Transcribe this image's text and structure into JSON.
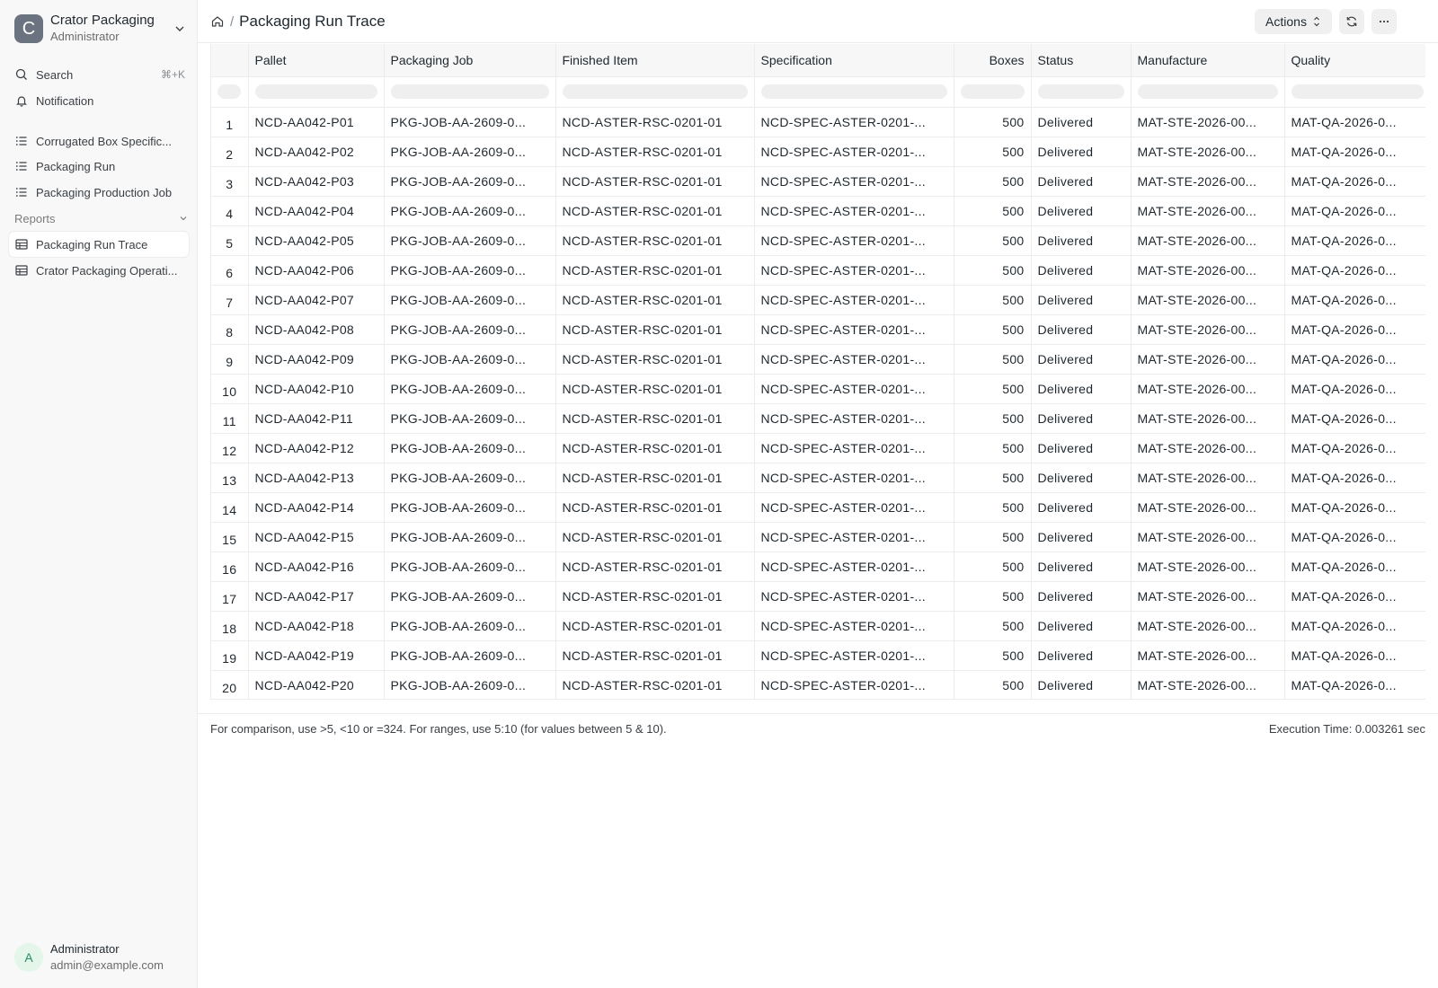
{
  "workspace": {
    "initial": "C",
    "name": "Crator Packaging",
    "role": "Administrator"
  },
  "sidebar": {
    "search_label": "Search",
    "search_shortcut": "⌘+K",
    "notification_label": "Notification",
    "items": [
      {
        "label": "Corrugated Box Specific...",
        "icon": "list-icon"
      },
      {
        "label": "Packaging Run",
        "icon": "list-icon"
      },
      {
        "label": "Packaging Production Job",
        "icon": "list-icon"
      }
    ],
    "reports_label": "Reports",
    "reports": [
      {
        "label": "Packaging Run Trace",
        "icon": "table-icon",
        "active": true
      },
      {
        "label": "Crator Packaging Operati...",
        "icon": "table-icon"
      }
    ]
  },
  "user": {
    "initial": "A",
    "name": "Administrator",
    "email": "admin@example.com"
  },
  "header": {
    "title": "Packaging Run Trace",
    "actions_label": "Actions"
  },
  "table": {
    "columns": [
      "Pallet",
      "Packaging Job",
      "Finished Item",
      "Specification",
      "Boxes",
      "Status",
      "Manufacture",
      "Quality"
    ],
    "rows": [
      [
        "1",
        "NCD-AA042-P01",
        "PKG-JOB-AA-2609-0...",
        "NCD-ASTER-RSC-0201-01",
        "NCD-SPEC-ASTER-0201-...",
        "500",
        "Delivered",
        "MAT-STE-2026-00...",
        "MAT-QA-2026-0..."
      ],
      [
        "2",
        "NCD-AA042-P02",
        "PKG-JOB-AA-2609-0...",
        "NCD-ASTER-RSC-0201-01",
        "NCD-SPEC-ASTER-0201-...",
        "500",
        "Delivered",
        "MAT-STE-2026-00...",
        "MAT-QA-2026-0..."
      ],
      [
        "3",
        "NCD-AA042-P03",
        "PKG-JOB-AA-2609-0...",
        "NCD-ASTER-RSC-0201-01",
        "NCD-SPEC-ASTER-0201-...",
        "500",
        "Delivered",
        "MAT-STE-2026-00...",
        "MAT-QA-2026-0..."
      ],
      [
        "4",
        "NCD-AA042-P04",
        "PKG-JOB-AA-2609-0...",
        "NCD-ASTER-RSC-0201-01",
        "NCD-SPEC-ASTER-0201-...",
        "500",
        "Delivered",
        "MAT-STE-2026-00...",
        "MAT-QA-2026-0..."
      ],
      [
        "5",
        "NCD-AA042-P05",
        "PKG-JOB-AA-2609-0...",
        "NCD-ASTER-RSC-0201-01",
        "NCD-SPEC-ASTER-0201-...",
        "500",
        "Delivered",
        "MAT-STE-2026-00...",
        "MAT-QA-2026-0..."
      ],
      [
        "6",
        "NCD-AA042-P06",
        "PKG-JOB-AA-2609-0...",
        "NCD-ASTER-RSC-0201-01",
        "NCD-SPEC-ASTER-0201-...",
        "500",
        "Delivered",
        "MAT-STE-2026-00...",
        "MAT-QA-2026-0..."
      ],
      [
        "7",
        "NCD-AA042-P07",
        "PKG-JOB-AA-2609-0...",
        "NCD-ASTER-RSC-0201-01",
        "NCD-SPEC-ASTER-0201-...",
        "500",
        "Delivered",
        "MAT-STE-2026-00...",
        "MAT-QA-2026-0..."
      ],
      [
        "8",
        "NCD-AA042-P08",
        "PKG-JOB-AA-2609-0...",
        "NCD-ASTER-RSC-0201-01",
        "NCD-SPEC-ASTER-0201-...",
        "500",
        "Delivered",
        "MAT-STE-2026-00...",
        "MAT-QA-2026-0..."
      ],
      [
        "9",
        "NCD-AA042-P09",
        "PKG-JOB-AA-2609-0...",
        "NCD-ASTER-RSC-0201-01",
        "NCD-SPEC-ASTER-0201-...",
        "500",
        "Delivered",
        "MAT-STE-2026-00...",
        "MAT-QA-2026-0..."
      ],
      [
        "10",
        "NCD-AA042-P10",
        "PKG-JOB-AA-2609-0...",
        "NCD-ASTER-RSC-0201-01",
        "NCD-SPEC-ASTER-0201-...",
        "500",
        "Delivered",
        "MAT-STE-2026-00...",
        "MAT-QA-2026-0..."
      ],
      [
        "11",
        "NCD-AA042-P11",
        "PKG-JOB-AA-2609-0...",
        "NCD-ASTER-RSC-0201-01",
        "NCD-SPEC-ASTER-0201-...",
        "500",
        "Delivered",
        "MAT-STE-2026-00...",
        "MAT-QA-2026-0..."
      ],
      [
        "12",
        "NCD-AA042-P12",
        "PKG-JOB-AA-2609-0...",
        "NCD-ASTER-RSC-0201-01",
        "NCD-SPEC-ASTER-0201-...",
        "500",
        "Delivered",
        "MAT-STE-2026-00...",
        "MAT-QA-2026-0..."
      ],
      [
        "13",
        "NCD-AA042-P13",
        "PKG-JOB-AA-2609-0...",
        "NCD-ASTER-RSC-0201-01",
        "NCD-SPEC-ASTER-0201-...",
        "500",
        "Delivered",
        "MAT-STE-2026-00...",
        "MAT-QA-2026-0..."
      ],
      [
        "14",
        "NCD-AA042-P14",
        "PKG-JOB-AA-2609-0...",
        "NCD-ASTER-RSC-0201-01",
        "NCD-SPEC-ASTER-0201-...",
        "500",
        "Delivered",
        "MAT-STE-2026-00...",
        "MAT-QA-2026-0..."
      ],
      [
        "15",
        "NCD-AA042-P15",
        "PKG-JOB-AA-2609-0...",
        "NCD-ASTER-RSC-0201-01",
        "NCD-SPEC-ASTER-0201-...",
        "500",
        "Delivered",
        "MAT-STE-2026-00...",
        "MAT-QA-2026-0..."
      ],
      [
        "16",
        "NCD-AA042-P16",
        "PKG-JOB-AA-2609-0...",
        "NCD-ASTER-RSC-0201-01",
        "NCD-SPEC-ASTER-0201-...",
        "500",
        "Delivered",
        "MAT-STE-2026-00...",
        "MAT-QA-2026-0..."
      ],
      [
        "17",
        "NCD-AA042-P17",
        "PKG-JOB-AA-2609-0...",
        "NCD-ASTER-RSC-0201-01",
        "NCD-SPEC-ASTER-0201-...",
        "500",
        "Delivered",
        "MAT-STE-2026-00...",
        "MAT-QA-2026-0..."
      ],
      [
        "18",
        "NCD-AA042-P18",
        "PKG-JOB-AA-2609-0...",
        "NCD-ASTER-RSC-0201-01",
        "NCD-SPEC-ASTER-0201-...",
        "500",
        "Delivered",
        "MAT-STE-2026-00...",
        "MAT-QA-2026-0..."
      ],
      [
        "19",
        "NCD-AA042-P19",
        "PKG-JOB-AA-2609-0...",
        "NCD-ASTER-RSC-0201-01",
        "NCD-SPEC-ASTER-0201-...",
        "500",
        "Delivered",
        "MAT-STE-2026-00...",
        "MAT-QA-2026-0..."
      ],
      [
        "20",
        "NCD-AA042-P20",
        "PKG-JOB-AA-2609-0...",
        "NCD-ASTER-RSC-0201-01",
        "NCD-SPEC-ASTER-0201-...",
        "500",
        "Delivered",
        "MAT-STE-2026-00...",
        "MAT-QA-2026-0..."
      ]
    ]
  },
  "footer": {
    "hint": "For comparison, use >5, <10 or =324. For ranges, use 5:10 (for values between 5 & 10).",
    "execution": "Execution Time: 0.003261 sec"
  },
  "colors": {
    "logo_bg": "#6b7280",
    "avatar_bg": "#e4f5e9",
    "avatar_fg": "#278f5e"
  }
}
